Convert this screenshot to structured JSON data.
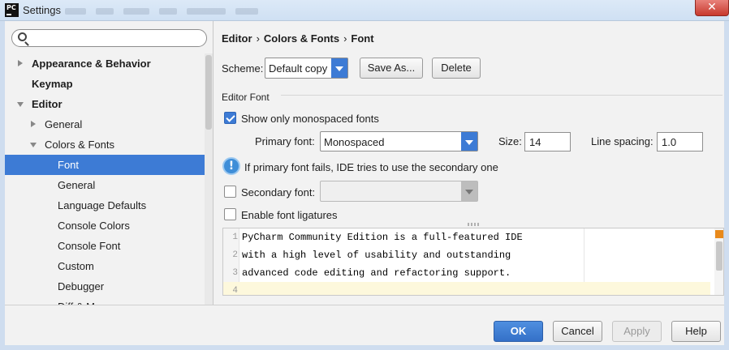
{
  "window": {
    "title": "Settings",
    "app_icon_text": "PC",
    "close_label": "✕"
  },
  "sidebar": {
    "search": {
      "value": "",
      "placeholder": ""
    },
    "items": [
      {
        "label": "Appearance & Behavior",
        "bold": true
      },
      {
        "label": "Keymap",
        "bold": true
      },
      {
        "label": "Editor",
        "bold": true
      },
      {
        "label": "General"
      },
      {
        "label": "Colors & Fonts"
      },
      {
        "label": "Font",
        "selected": true
      },
      {
        "label": "General"
      },
      {
        "label": "Language Defaults"
      },
      {
        "label": "Console Colors"
      },
      {
        "label": "Console Font"
      },
      {
        "label": "Custom"
      },
      {
        "label": "Debugger"
      },
      {
        "label": "Diff & Merge"
      }
    ]
  },
  "breadcrumb": {
    "items": [
      "Editor",
      "Colors & Fonts",
      "Font"
    ],
    "separator": "›"
  },
  "scheme": {
    "label": "Scheme:",
    "value": "Default copy",
    "save_as": "Save As...",
    "delete": "Delete"
  },
  "editor_font": {
    "section_title": "Editor Font",
    "show_mono_label": "Show only monospaced fonts",
    "show_mono_checked": true,
    "primary_font_label": "Primary font:",
    "primary_font_value": "Monospaced",
    "size_label": "Size:",
    "size_value": "14",
    "line_spacing_label": "Line spacing:",
    "line_spacing_value": "1.0",
    "info_text": "If primary font fails, IDE tries to use the secondary one",
    "secondary_font_label": "Secondary font:",
    "secondary_font_value": "",
    "secondary_checked": false,
    "ligatures_label": "Enable font ligatures",
    "ligatures_checked": false
  },
  "preview": {
    "lines": [
      {
        "num": "1",
        "text": "PyCharm Community Edition is a full-featured IDE"
      },
      {
        "num": "2",
        "text": "with a high level of usability and outstanding"
      },
      {
        "num": "3",
        "text": "advanced code editing and refactoring support."
      },
      {
        "num": "4",
        "text": ""
      }
    ]
  },
  "buttons": {
    "ok": "OK",
    "cancel": "Cancel",
    "apply": "Apply",
    "help": "Help"
  },
  "colors": {
    "accent": "#3d7bd5",
    "title_bar": "#dce9f7",
    "close": "#c7392d",
    "marker": "#e8891b"
  }
}
